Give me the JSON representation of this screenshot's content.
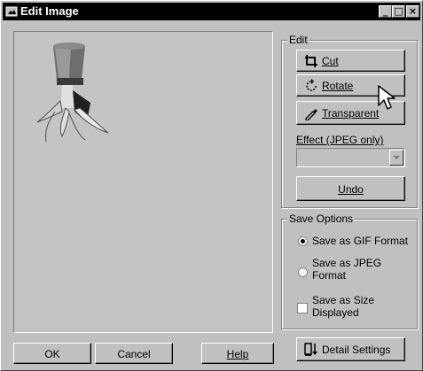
{
  "window": {
    "title": "Edit Image"
  },
  "titlebar": {
    "minimize": "_",
    "maximize": "□",
    "close": "×"
  },
  "edit_group": {
    "legend": "Edit",
    "cut": "Cut",
    "rotate": "Rotate",
    "transparent": "Transparent",
    "effect_label": "Effect (JPEG only)",
    "effect_value": "",
    "undo": "Undo"
  },
  "save_options": {
    "legend": "Save Options",
    "gif_line1": "Save as GIF Format",
    "jpeg_line1": "Save as JPEG",
    "jpeg_line2": "Format",
    "size_line1": "Save as Size",
    "size_line2": "Displayed",
    "selected": "gif",
    "size_checked": false
  },
  "footer": {
    "ok": "OK",
    "cancel": "Cancel",
    "help": "Help",
    "detail_settings": "Detail Settings"
  },
  "icons": {
    "app": "image-edit-icon",
    "cut": "crop-icon",
    "rotate": "rotate-icon",
    "transparent": "eyedropper-icon",
    "detail": "detail-settings-icon",
    "cursor": "mouse-pointer-icon"
  }
}
